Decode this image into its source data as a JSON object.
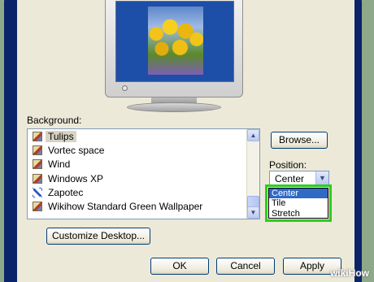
{
  "background": {
    "label": "Background:",
    "items": [
      {
        "label": "Tulips",
        "icon": "image-file-icon",
        "selected": true
      },
      {
        "label": "Vortec space",
        "icon": "image-file-icon",
        "selected": false
      },
      {
        "label": "Wind",
        "icon": "image-file-icon",
        "selected": false
      },
      {
        "label": "Windows XP",
        "icon": "image-file-icon",
        "selected": false
      },
      {
        "label": "Zapotec",
        "icon": "pen-icon",
        "selected": false
      },
      {
        "label": "Wikihow Standard Green Wallpaper",
        "icon": "image-file-icon",
        "selected": false
      }
    ],
    "browse_label": "Browse..."
  },
  "position": {
    "label": "Position:",
    "selected": "Center",
    "options": [
      "Center",
      "Tile",
      "Stretch"
    ],
    "highlight_color": "#2ecc1e"
  },
  "customize_label": "Customize Desktop...",
  "buttons": {
    "ok": "OK",
    "cancel": "Cancel",
    "apply": "Apply"
  },
  "watermark": {
    "wiki": "wiki",
    "how": "How"
  },
  "colors": {
    "selection": "#316ac5",
    "page_background": "#8ea88a",
    "dialog": "#ece9d8"
  }
}
